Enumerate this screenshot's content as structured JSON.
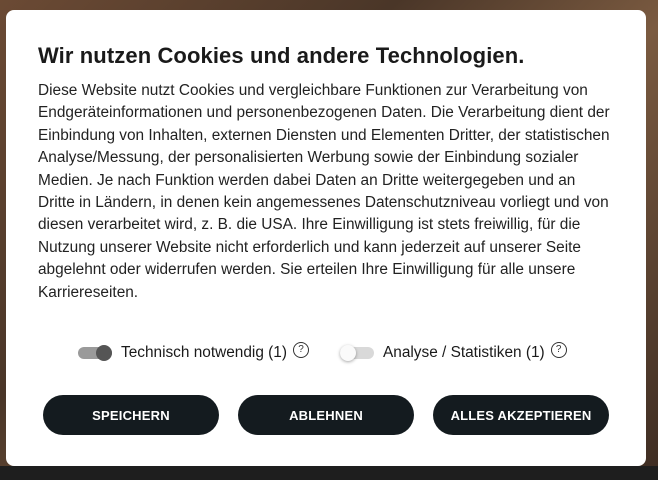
{
  "dialog": {
    "title": "Wir nutzen Cookies und andere Technologien.",
    "body": "Diese Website nutzt Cookies und vergleichbare Funktionen zur Verarbeitung von Endgeräteinformationen und personenbezogenen Daten. Die Verarbeitung dient der Einbindung von Inhalten, externen Diensten und Elementen Dritter, der statistischen Analyse/Messung, der personalisierten Werbung sowie der Einbindung sozialer Medien. Je nach Funktion werden dabei Daten an Dritte weitergegeben und an Dritte in Ländern, in denen kein angemessenes Datenschutzniveau vorliegt und von diesen verarbeitet wird, z. B. die USA. Ihre Einwilligung ist stets freiwillig, für die Nutzung unserer Website nicht erforderlich und kann jederzeit auf unserer Seite abgelehnt oder widerrufen werden. Sie erteilen Ihre Einwilligung für alle unsere Karriereseiten."
  },
  "toggles": [
    {
      "label": "Technisch notwendig (1)",
      "enabled": true,
      "help_glyph": "?"
    },
    {
      "label": "Analyse / Statistiken (1)",
      "enabled": false,
      "help_glyph": "?"
    }
  ],
  "buttons": {
    "save": "SPEICHERN",
    "reject": "ABLEHNEN",
    "accept_all": "ALLES AKZEPTIEREN"
  },
  "colors": {
    "button_bg": "#141b1f",
    "button_text": "#ffffff",
    "dialog_bg": "#ffffff"
  },
  "icons": {
    "help": "question-circle-icon"
  }
}
